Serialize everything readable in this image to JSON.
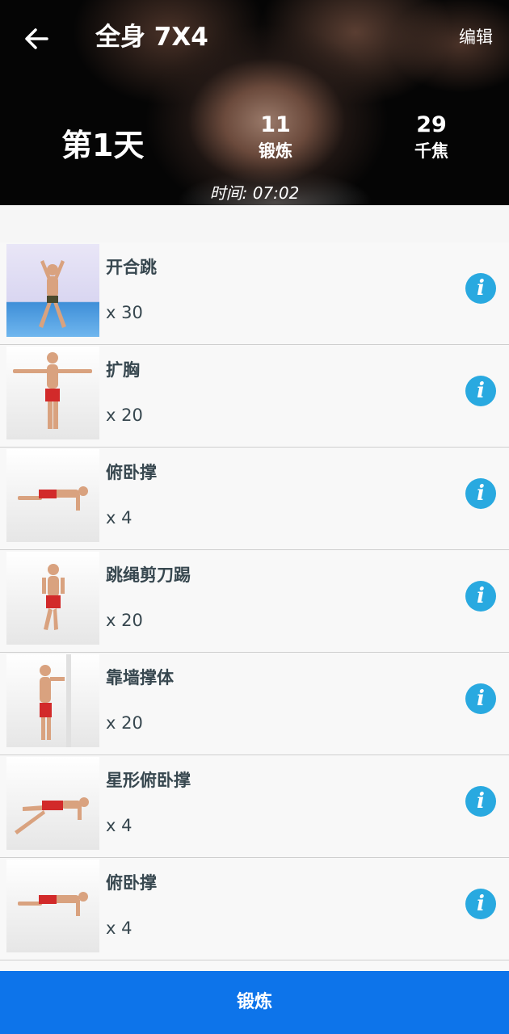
{
  "header": {
    "title": "全身 7X4",
    "edit_label": "编辑",
    "day_label": "第1天",
    "stats": [
      {
        "value": "11",
        "label": "锻炼"
      },
      {
        "value": "29",
        "label": "千焦"
      }
    ],
    "time_label": "时间: 07:02"
  },
  "exercises": [
    {
      "name": "开合跳",
      "reps": "x 30"
    },
    {
      "name": "扩胸",
      "reps": "x 20"
    },
    {
      "name": "俯卧撑",
      "reps": "x 4"
    },
    {
      "name": "跳绳剪刀踢",
      "reps": "x 20"
    },
    {
      "name": "靠墙撑体",
      "reps": "x 20"
    },
    {
      "name": "星形俯卧撑",
      "reps": "x 4"
    },
    {
      "name": "俯卧撑",
      "reps": "x 4"
    }
  ],
  "footer": {
    "start_label": "锻炼"
  },
  "colors": {
    "primary_button": "#0d74ea",
    "info_icon": "#29a9e0",
    "text_dark": "#37474f"
  },
  "icons": {
    "back": "arrow-left-icon",
    "info": "info-icon"
  }
}
